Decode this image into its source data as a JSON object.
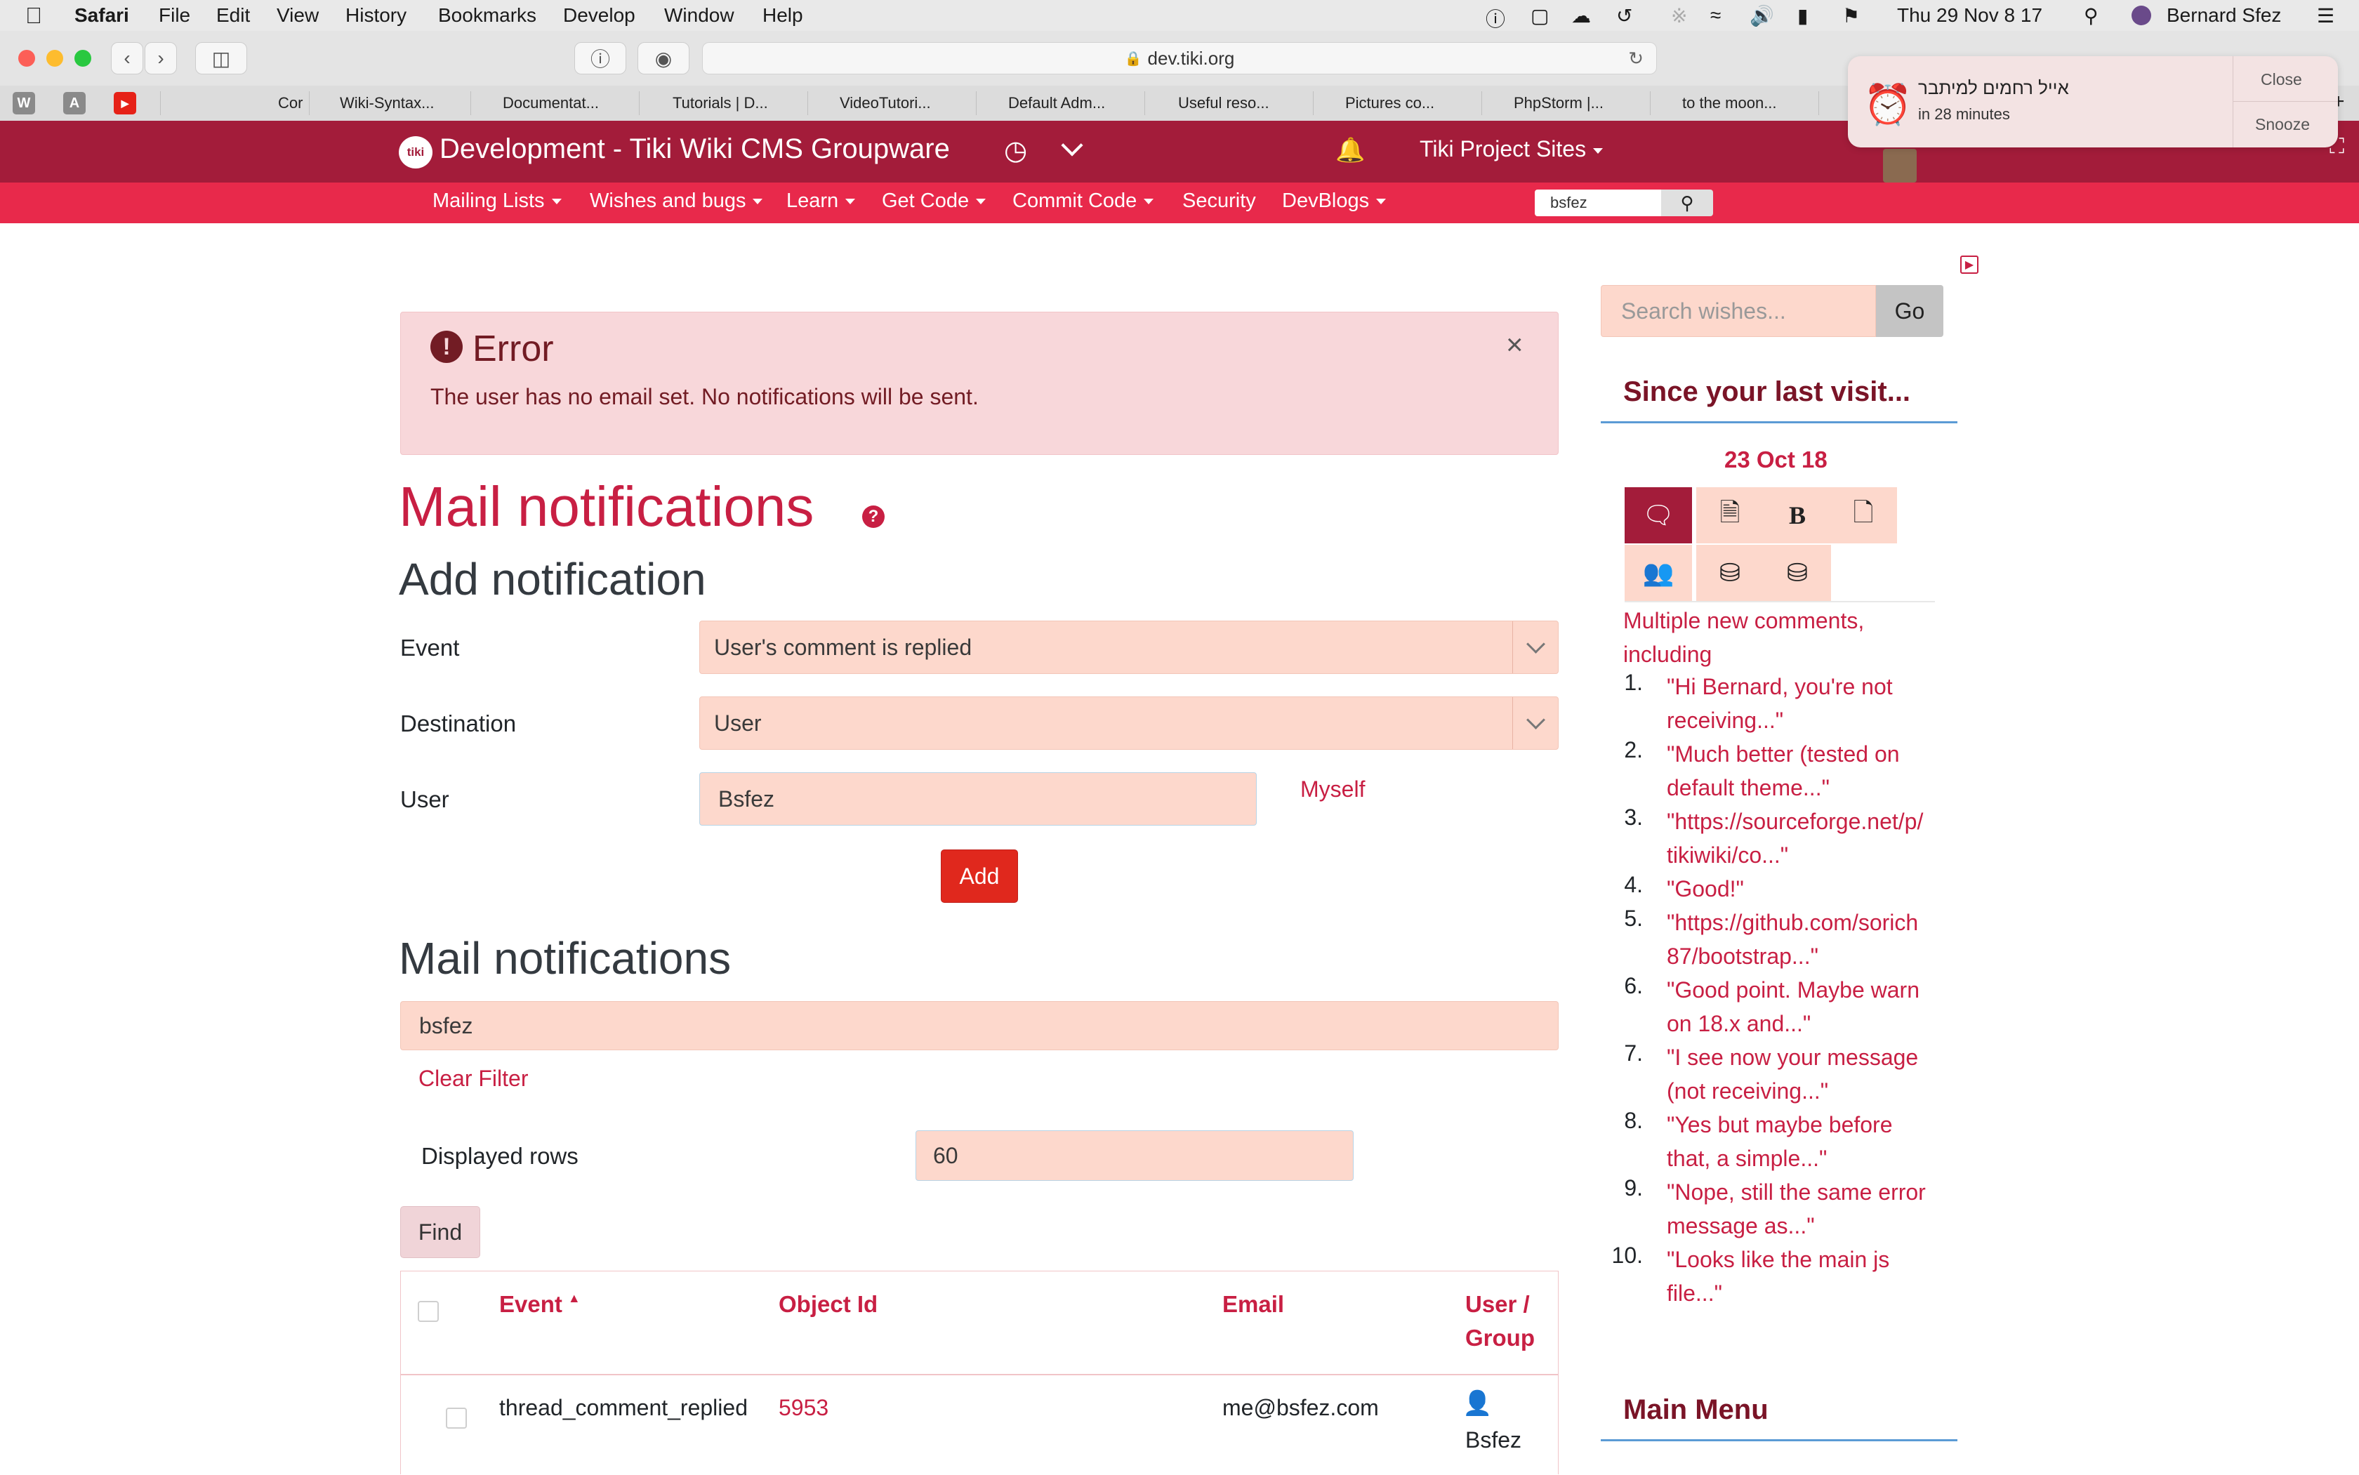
{
  "menubar": {
    "app": "Safari",
    "items": [
      "File",
      "Edit",
      "View",
      "History",
      "Bookmarks",
      "Develop",
      "Window",
      "Help"
    ],
    "clock": "Thu 29 Nov  8 17",
    "user": "Bernard Sfez"
  },
  "browser": {
    "url": "dev.tiki.org",
    "bookmarks": [
      "Cor",
      "Wiki-Syntax...",
      "Documentat...",
      "Tutorials | D...",
      "VideoTutori...",
      "Default Adm...",
      "Useful reso...",
      "Pictures co...",
      "PhpStorm |...",
      "to the moon..."
    ],
    "favicons": [
      "W",
      "A",
      "▶"
    ]
  },
  "notification": {
    "title": "אייל רחמים למיתבר",
    "subtitle": "in 28 minutes",
    "close": "Close",
    "snooze": "Snooze"
  },
  "site": {
    "title": "Development - Tiki Wiki CMS Groupware",
    "logo": "tiki",
    "project_sites": "Tiki Project Sites",
    "nav": [
      "Mailing Lists",
      "Wishes and bugs",
      "Learn",
      "Get Code",
      "Commit Code",
      "Security",
      "DevBlogs"
    ],
    "nav_has_caret": [
      true,
      true,
      true,
      true,
      true,
      false,
      true
    ],
    "search_value": "bsfez"
  },
  "error": {
    "title": "Error",
    "message": "The user has no email set. No notifications will be sent."
  },
  "page": {
    "title": "Mail notifications",
    "add_heading": "Add notification",
    "event_label": "Event",
    "event_value": "User's comment is replied",
    "destination_label": "Destination",
    "destination_value": "User",
    "user_label": "User",
    "user_value": "Bsfez",
    "myself": "Myself",
    "add_button": "Add",
    "list_heading": "Mail notifications",
    "filter_value": "bsfez",
    "clear_filter": "Clear Filter",
    "rows_label": "Displayed rows",
    "rows_value": "60",
    "find_button": "Find"
  },
  "table": {
    "headers": {
      "event": "Event",
      "object_id": "Object Id",
      "email": "Email",
      "user_group": "User /",
      "user_group2": "Group"
    },
    "rows": [
      {
        "event": "thread_comment_replied",
        "object_id": "5953",
        "email": "me@bsfez.com",
        "user": "Bsfez"
      }
    ]
  },
  "sidebar": {
    "search_placeholder": "Search wishes...",
    "go": "Go",
    "since_heading": "Since your last visit...",
    "date": "23 Oct 18",
    "comments_intro_1": "Multiple new comments,",
    "comments_intro_2": "including",
    "comments": [
      [
        "\"Hi Bernard, you're not",
        "receiving...\""
      ],
      [
        "\"Much better (tested on",
        "default theme...\""
      ],
      [
        "\"https://sourceforge.net/p/",
        "tikiwiki/co...\""
      ],
      [
        "\"Good!\""
      ],
      [
        "\"https://github.com/sorich",
        "87/bootstrap...\""
      ],
      [
        "\"Good point. Maybe warn",
        "on 18.x and...\""
      ],
      [
        "\"I see now your message",
        "(not receiving...\""
      ],
      [
        "\"Yes but maybe before",
        "that, a simple...\""
      ],
      [
        "\"Nope, still the same error",
        "message as...\""
      ],
      [
        "\"Looks like the main js",
        "file...\""
      ]
    ],
    "main_menu": "Main Menu"
  },
  "colors": {
    "topbar": "#a31c3a",
    "navbar": "#e8294b",
    "accent": "#c81f43",
    "input_bg": "#fdd8cc",
    "error_bg": "#f8d7da",
    "add_button": "#e0281d"
  }
}
